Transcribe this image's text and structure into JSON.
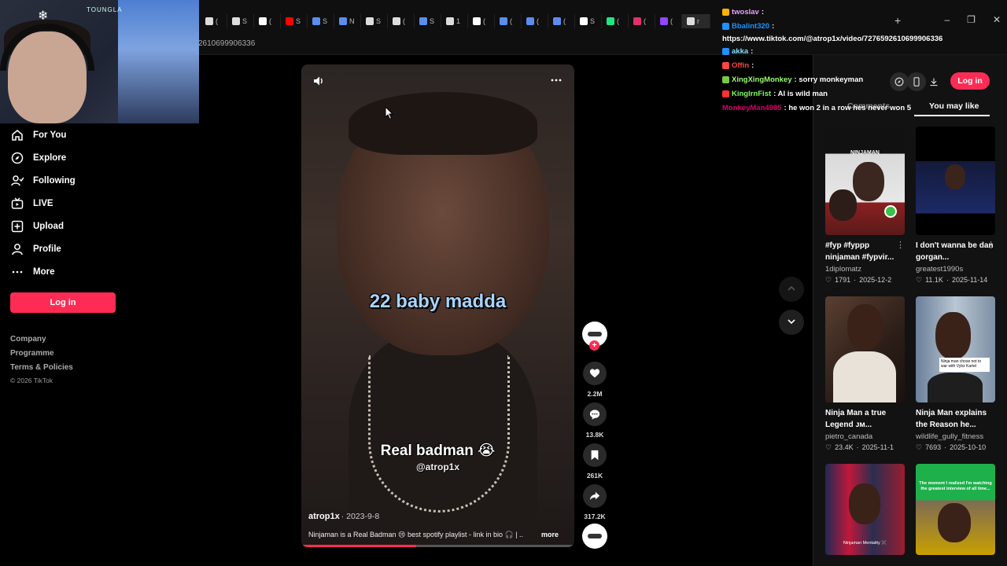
{
  "browser": {
    "url_partial": "2610699906336",
    "url_full": "https://www.tiktok.com/@atrop1x/video/7276592610699906336",
    "tab_icons": [
      "x",
      "x",
      "tiktok",
      "youtube",
      "generic",
      "generic",
      "x",
      "x",
      "generic",
      "x",
      "tiktok",
      "generic",
      "generic",
      "generic",
      "tiktok",
      "k",
      "instagram",
      "twitch",
      "x"
    ],
    "tab_labels": [
      "(",
      "S",
      "(",
      "S",
      "S",
      "N",
      "S",
      "(",
      "S",
      "1",
      "(",
      "(",
      "(",
      "(",
      "S",
      "(",
      "(",
      "(",
      "r"
    ],
    "new_tab": "+",
    "win": [
      "–",
      "❐",
      "✕"
    ]
  },
  "webcam": {
    "logo": "TOUNGLA",
    "snow": "❄"
  },
  "sidebar": {
    "items": [
      {
        "label": "For You",
        "icon": "home-icon"
      },
      {
        "label": "Explore",
        "icon": "compass-icon"
      },
      {
        "label": "Following",
        "icon": "following-icon"
      },
      {
        "label": "LIVE",
        "icon": "live-icon"
      },
      {
        "label": "Upload",
        "icon": "upload-icon"
      },
      {
        "label": "Profile",
        "icon": "profile-icon"
      },
      {
        "label": "More",
        "icon": "more-icon"
      }
    ],
    "login": "Log in",
    "footer": [
      "Company",
      "Programme",
      "Terms & Policies"
    ],
    "copyright": "© 2026 TikTok"
  },
  "video": {
    "caption_top": "22 baby madda",
    "caption_bottom": "Real badman 😭",
    "watermark": "@atrop1x",
    "author": "atrop1x",
    "date": "· 2023-9-8",
    "description": "Ninjaman is a Real Badman 😢 best spotify playlist - link in bio 🎧 | ..",
    "more": "more",
    "progress": 0.42
  },
  "actions": {
    "likes": "2.2M",
    "comments": "13.8K",
    "saves": "261K",
    "shares": "317.2K"
  },
  "chat": [
    {
      "user": "twoslav",
      "msg": ":",
      "color": "#e8a0ff",
      "badge": "#ffb300"
    },
    {
      "user": "Bbalint320",
      "msg": ":",
      "color": "#1e90ff",
      "badge": "#1e90ff"
    },
    {
      "user": "akka",
      "msg": ":",
      "color": "#7fdfff",
      "badge": "#1e90ff"
    },
    {
      "user": "Offin",
      "msg": ":",
      "color": "#ff4444",
      "badge": "#ff4444"
    },
    {
      "user": "XingXingMonkey",
      "msg": ": sorry monkeyman",
      "color": "#9aff6b",
      "badge": "#7ac943"
    },
    {
      "user": "KingIrnFist",
      "msg": ": AI is wild man",
      "color": "#7cff5a",
      "badge": "#ff3030"
    },
    {
      "user": "MonkeyMan4985",
      "msg": ": he won 2 in a row hes never won 5",
      "color": "#d4006a",
      "badge": ""
    }
  ],
  "right_panel": {
    "tabs": [
      "Comments",
      "You may like"
    ],
    "login": "Log in",
    "cards": [
      {
        "title": "#fyp #fyppp ninjaman #fypvir...",
        "author": "1diplomatz",
        "likes": "1791",
        "date": "2025-12-2",
        "thumb_label": "NINJAMAN"
      },
      {
        "title": "I don't wanna be dan gorgan...",
        "author": "greatest1990s",
        "likes": "11.1K",
        "date": "2025-11-14",
        "thumb_label": ""
      },
      {
        "title": "Ninja Man a true Legend ᴊᴍ...",
        "author": "pietro_canada",
        "likes": "23.4K",
        "date": "2025-11-1",
        "thumb_label": ""
      },
      {
        "title": "Ninja Man explains the Reason he...",
        "author": "wildlife_gully_fitness",
        "likes": "7693",
        "date": "2025-10-10",
        "thumb_label": "Ninja man chose not to war with Vybz Kartel"
      },
      {
        "title": "",
        "author": "",
        "likes": "",
        "date": "",
        "thumb_label": "Ninjaman Mentality ✖️"
      },
      {
        "title": "",
        "author": "",
        "likes": "",
        "date": "",
        "thumb_label": "The moment I realized I'm watching the greatest interview of all time..."
      }
    ]
  }
}
